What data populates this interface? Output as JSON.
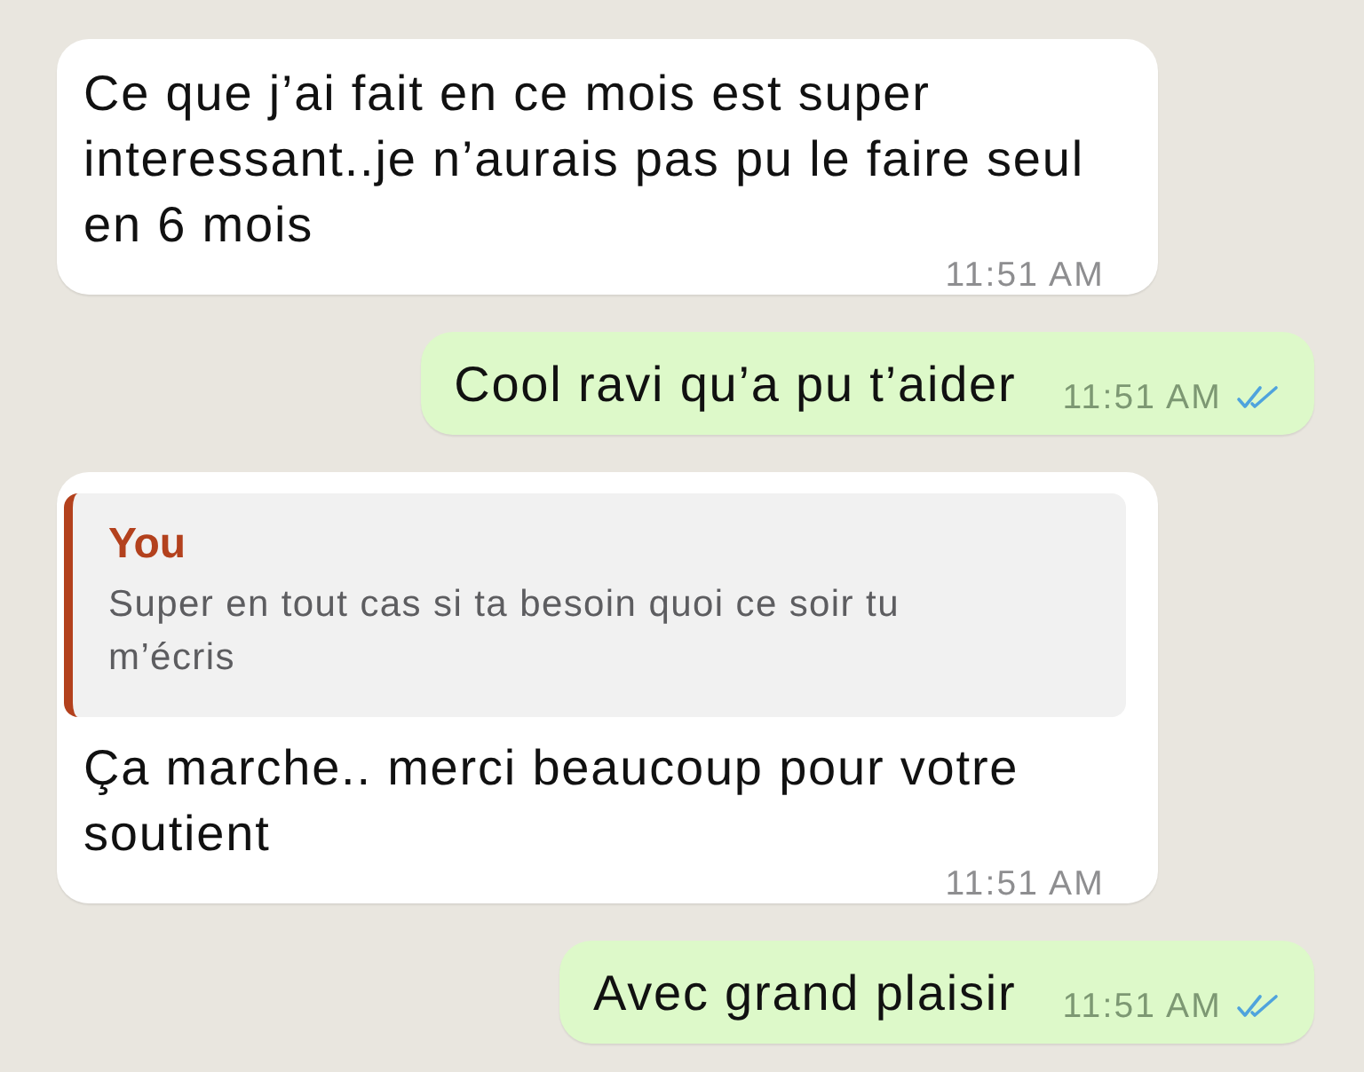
{
  "messages": [
    {
      "kind": "incoming",
      "text": "Ce que j’ai fait en ce mois est super interessant..je n’aurais pas pu le faire seul en 6 mois",
      "time": "11:51 AM"
    },
    {
      "kind": "outgoing",
      "text": "Cool ravi qu’a pu t’aider",
      "time": "11:51 AM",
      "read": true
    },
    {
      "kind": "incoming",
      "reply": {
        "author": "You",
        "text": "Super en tout cas si ta besoin quoi ce soir tu m’écris"
      },
      "text": "Ça marche.. merci beaucoup pour votre soutient",
      "time": "11:51 AM"
    },
    {
      "kind": "outgoing",
      "text": "Avec grand plaisir",
      "time": "11:51 AM",
      "read": true
    }
  ]
}
